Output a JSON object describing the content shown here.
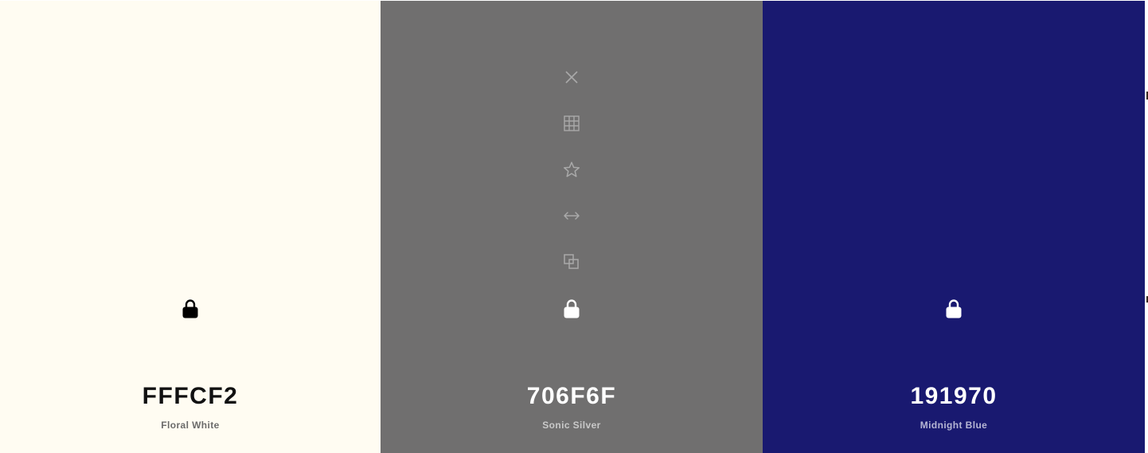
{
  "palette": {
    "colors": [
      {
        "hex": "FFFCF2",
        "name": "Floral White",
        "background": "#FFFCF2",
        "hex_color": "#111111",
        "name_color": "#6b6b6b",
        "icon_color": "#000000",
        "lock_icon": "lock-icon"
      },
      {
        "hex": "706F6F",
        "name": "Sonic Silver",
        "background": "#706F6F",
        "hex_color": "#FFFFFF",
        "name_color": "#c9c9c9",
        "icon_color": "#FFFFFF",
        "tool_color": "#a9a9a9",
        "tools": [
          "close-icon",
          "grid-icon",
          "star-icon",
          "arrows-horizontal-icon",
          "copy-icon"
        ],
        "lock_icon": "lock-icon"
      },
      {
        "hex": "191970",
        "name": "Midnight Blue",
        "background": "#191970",
        "hex_color": "#FFFFFF",
        "name_color": "#b6b6d4",
        "icon_color": "#FFFFFF",
        "lock_icon": "lock-icon"
      }
    ]
  }
}
